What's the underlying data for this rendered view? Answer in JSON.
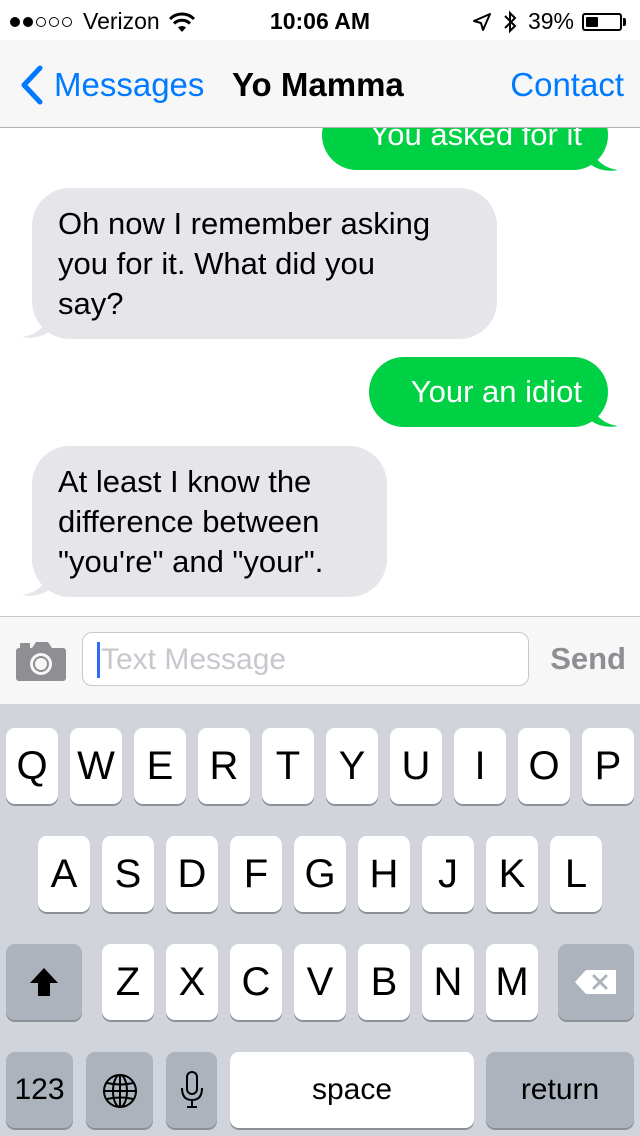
{
  "status_bar": {
    "carrier": "Verizon",
    "time": "10:06 AM",
    "battery": "39%",
    "battery_level": 0.39,
    "signal_bars_filled": 2,
    "signal_bars_total": 5
  },
  "nav": {
    "back_label": "Messages",
    "title": "Yo Mamma",
    "contact_label": "Contact"
  },
  "messages": [
    {
      "direction": "out",
      "text": "You asked for it"
    },
    {
      "direction": "in",
      "lines": [
        "Oh now I remember asking",
        "you for it. What did you",
        "say?"
      ]
    },
    {
      "direction": "out",
      "text": "Your an idiot"
    },
    {
      "direction": "in",
      "lines": [
        "At least I know the",
        "difference between",
        "\"you're\" and \"your\"."
      ]
    }
  ],
  "composer": {
    "placeholder": "Text Message",
    "send_label": "Send"
  },
  "keyboard": {
    "row1": [
      "Q",
      "W",
      "E",
      "R",
      "T",
      "Y",
      "U",
      "I",
      "O",
      "P"
    ],
    "row2": [
      "A",
      "S",
      "D",
      "F",
      "G",
      "H",
      "J",
      "K",
      "L"
    ],
    "row3": [
      "Z",
      "X",
      "C",
      "V",
      "B",
      "N",
      "M"
    ],
    "numbers_label": "123",
    "space_label": "space",
    "return_label": "return"
  },
  "colors": {
    "ios_blue": "#007aff",
    "sms_green": "#00d044",
    "incoming_gray": "#e5e5ea",
    "keyboard_bg": "#d1d5db"
  },
  "icons": [
    "wifi-icon",
    "location-arrow-icon",
    "bluetooth-icon",
    "battery-icon",
    "back-chevron-icon",
    "camera-icon",
    "shift-icon",
    "delete-icon",
    "globe-icon",
    "microphone-icon"
  ]
}
